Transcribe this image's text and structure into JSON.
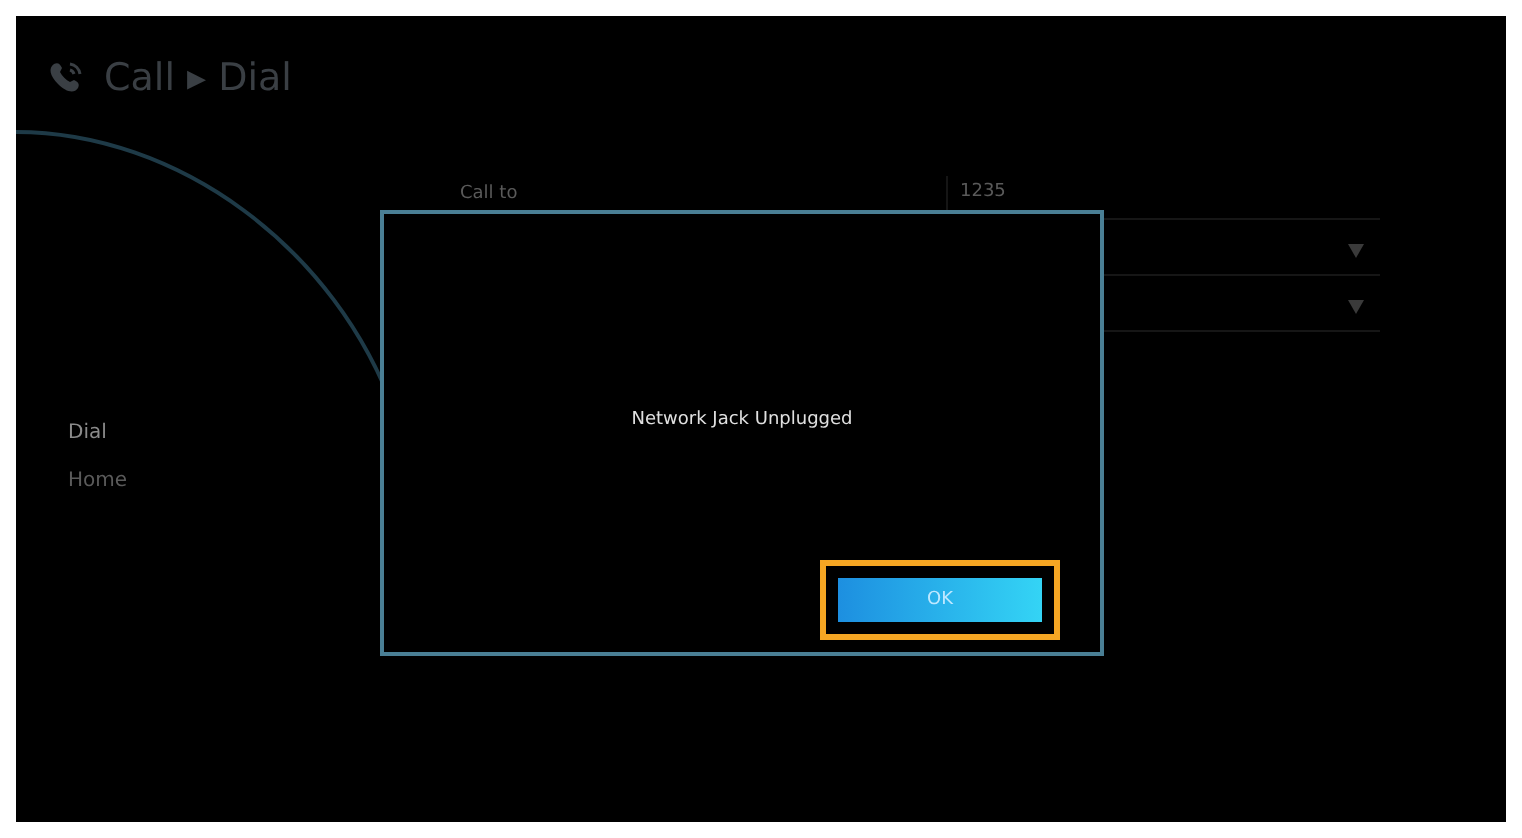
{
  "header": {
    "title": "Call ▸ Dial"
  },
  "sidebar": {
    "items": [
      {
        "label": "Dial",
        "selected": true
      },
      {
        "label": "Home",
        "selected": false
      }
    ]
  },
  "form": {
    "call_to": {
      "label": "Call to",
      "value": "1235"
    },
    "dropdowns": [
      {
        "kind": "select"
      },
      {
        "kind": "select"
      }
    ]
  },
  "dialog": {
    "message": "Network Jack Unplugged",
    "buttons": [
      {
        "label": "OK",
        "focused": true
      }
    ]
  }
}
